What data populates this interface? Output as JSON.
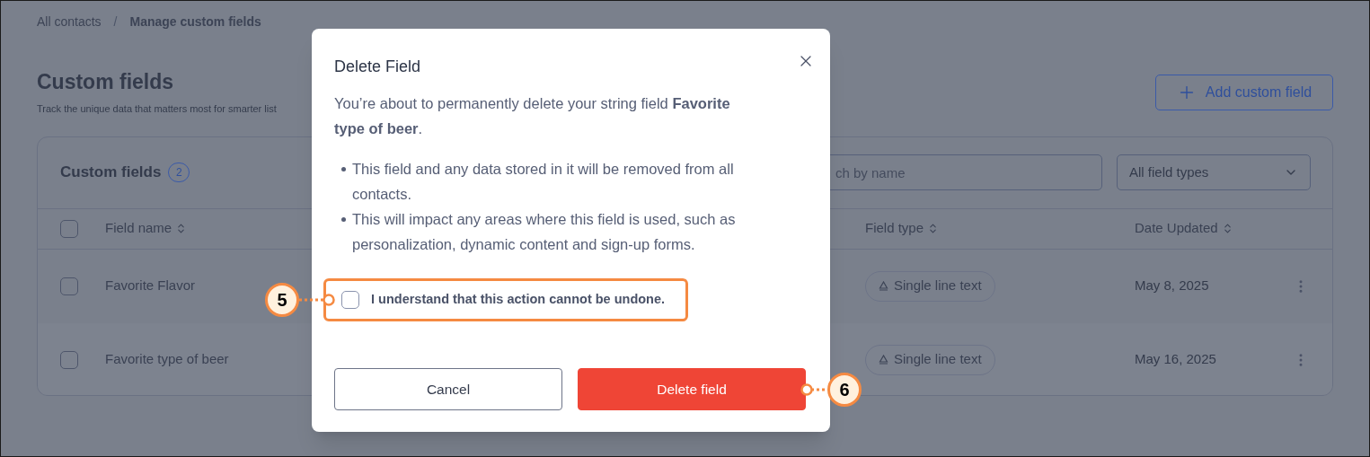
{
  "breadcrumb": {
    "items": [
      {
        "label": "All contacts",
        "current": false
      },
      {
        "label": "Manage custom fields",
        "current": true
      }
    ],
    "separator": "/"
  },
  "header": {
    "title": "Custom fields",
    "subtitle": "Track the unique data that matters most for smarter list",
    "add_button": "Add custom field"
  },
  "card": {
    "title": "Custom fields",
    "count": "2",
    "search": {
      "placeholder": "ch by name"
    },
    "filter": {
      "value": "All field types"
    },
    "select_all": {
      "checked": false
    },
    "columns": [
      "Field name",
      "Field type",
      "Date Updated"
    ],
    "rows": [
      {
        "name": "Favorite Flavor",
        "field_type": "Single line text",
        "date": "May 8, 2025",
        "checked": false
      },
      {
        "name": "Favorite type of beer",
        "field_type": "Single line text",
        "date": "May 16, 2025",
        "checked": false
      }
    ]
  },
  "dialog": {
    "title": "Delete Field",
    "message": "You’re about to permanently delete your string field **Favorite type of beer**.",
    "bullets": [
      "This field and any data stored in it will be removed from all contacts.",
      "This will impact any areas where this field is used, such as personalization, dynamic content and sign-up forms."
    ],
    "confirm": {
      "label": "I understand that this action cannot be undone.",
      "checked": false
    },
    "buttons": [
      {
        "label": "Cancel",
        "kind": "secondary"
      },
      {
        "label": "Delete field",
        "kind": "danger"
      }
    ]
  },
  "callouts": [
    {
      "number": "5"
    },
    {
      "number": "6"
    }
  ]
}
